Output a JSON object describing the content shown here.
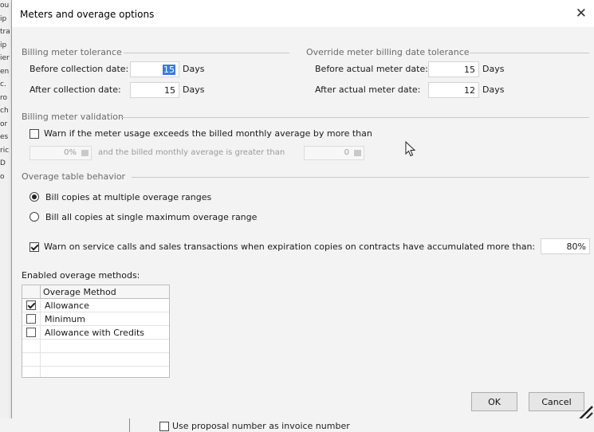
{
  "dialog": {
    "title": "Meters and overage options",
    "close_glyph": "✕"
  },
  "background": {
    "fragments": [
      "ou",
      "ip",
      "tra",
      "ip",
      "ier",
      "en",
      "c.",
      "ro",
      "ch",
      "or",
      "es",
      "ric",
      "D",
      "o"
    ],
    "below_checkbox_label": "Use proposal number as invoice number"
  },
  "billing_tolerance": {
    "title": "Billing meter tolerance",
    "before_label": "Before collection date:",
    "before_value": "15",
    "after_label": "After collection date:",
    "after_value": "15",
    "unit": "Days"
  },
  "override_tolerance": {
    "title": "Override meter billing date tolerance",
    "before_label": "Before actual meter date:",
    "before_value": "15",
    "after_label": "After actual meter date:",
    "after_value": "12",
    "unit": "Days"
  },
  "validation": {
    "title": "Billing meter validation",
    "warn_label": "Warn if the meter usage exceeds the billed monthly average by more than",
    "warn_checked": false,
    "percent_value": "0%",
    "and_label": "and the billed monthly average is greater than",
    "amount_value": "0"
  },
  "overage_behavior": {
    "title": "Overage table behavior",
    "option_multiple": "Bill copies at multiple overage ranges",
    "option_single": "Bill all copies at single maximum overage range",
    "selected": "multiple",
    "warn_label": "Warn on service calls and sales transactions when expiration copies on contracts have accumulated more than:",
    "warn_checked": true,
    "warn_value": "80%"
  },
  "enabled_methods": {
    "title": "Enabled overage methods:",
    "column_header": "Overage Method",
    "rows": [
      {
        "label": "Allowance",
        "checked": true
      },
      {
        "label": "Minimum",
        "checked": false
      },
      {
        "label": "Allowance with Credits",
        "checked": false
      }
    ]
  },
  "buttons": {
    "ok": "OK",
    "cancel": "Cancel"
  },
  "icons": {
    "close": "close-icon",
    "cursor": "mouse-pointer-icon",
    "resize": "resize-grip-icon",
    "spin": "spin-button-icon",
    "check": "checkmark-icon"
  }
}
